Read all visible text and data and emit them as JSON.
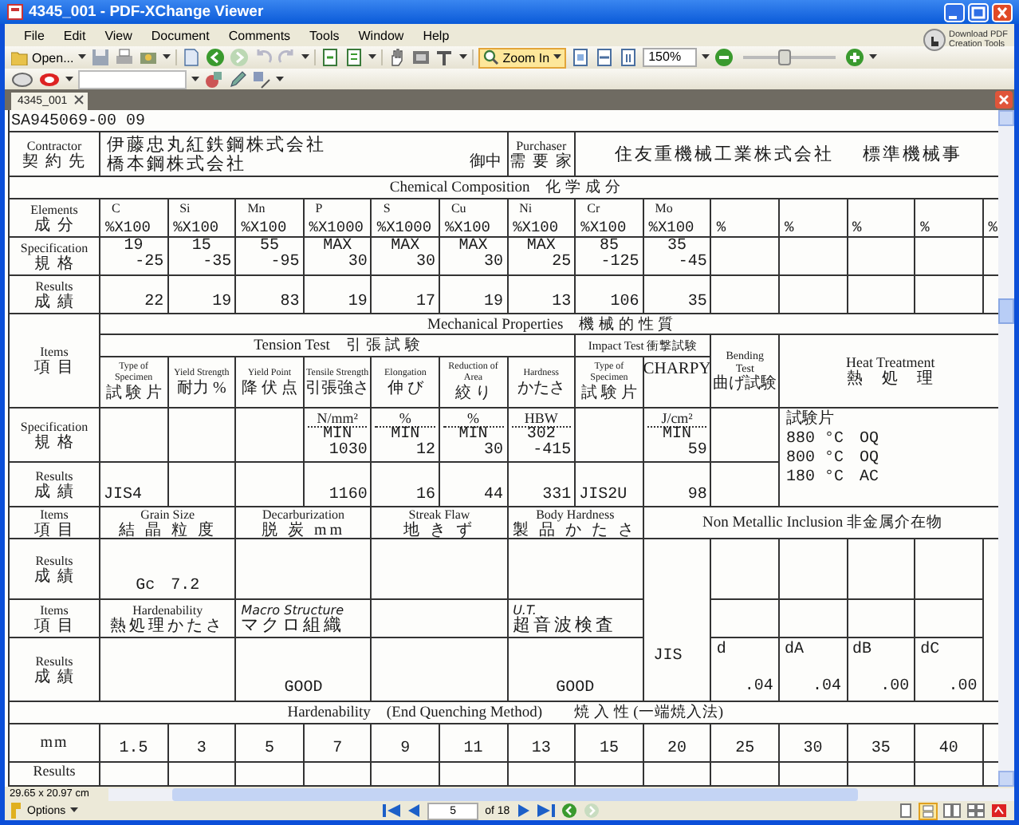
{
  "window": {
    "title": "4345_001 - PDF-XChange Viewer"
  },
  "menu": [
    "File",
    "Edit",
    "View",
    "Document",
    "Comments",
    "Tools",
    "Window",
    "Help"
  ],
  "promo": [
    "Download PDF",
    "Creation Tools"
  ],
  "toolbar": {
    "open_label": "Open...",
    "zoom_tool": {
      "label": "Zoom In",
      "selected": true
    },
    "zoom_value": "150%",
    "zoom_slider": {
      "level": 0.45
    }
  },
  "tabs": [
    {
      "label": "4345_001",
      "selected": true
    }
  ],
  "document": {
    "cert_number": "SA945069-00 09",
    "contractor": {
      "en": "Contractor",
      "ja": "契 約 先",
      "lines": [
        "伊藤忠丸紅鉄鋼株式会社",
        "橋本鋼株式会社"
      ],
      "suffix": "御中"
    },
    "purchaser": {
      "en": "Purchaser",
      "ja": "需 要 家",
      "name": "住友重機械工業株式会社",
      "division": "標準機械事"
    },
    "chemical": {
      "title": "Chemical Composition　化 学 成 分",
      "row_labels": [
        {
          "en": "Elements",
          "ja": "成 分"
        },
        {
          "en": "Specification",
          "ja": "規 格"
        },
        {
          "en": "Results",
          "ja": "成 績"
        }
      ],
      "columns": [
        {
          "element": "C",
          "unit": "%X100",
          "spec": [
            "19",
            "-25"
          ],
          "result": "22"
        },
        {
          "element": "Si",
          "unit": "%X100",
          "spec": [
            "15",
            "-35"
          ],
          "result": "19"
        },
        {
          "element": "Mn",
          "unit": "%X100",
          "spec": [
            "55",
            "-95"
          ],
          "result": "83"
        },
        {
          "element": "P",
          "unit": "%X1000",
          "spec": [
            "MAX",
            "30"
          ],
          "result": "19"
        },
        {
          "element": "S",
          "unit": "%X1000",
          "spec": [
            "MAX",
            "30"
          ],
          "result": "17"
        },
        {
          "element": "Cu",
          "unit": "%X100",
          "spec": [
            "MAX",
            "30"
          ],
          "result": "19"
        },
        {
          "element": "Ni",
          "unit": "%X100",
          "spec": [
            "MAX",
            "25"
          ],
          "result": "13"
        },
        {
          "element": "Cr",
          "unit": "%X100",
          "spec": [
            "85",
            "-125"
          ],
          "result": "106"
        },
        {
          "element": "Mo",
          "unit": "%X100",
          "spec": [
            "35",
            "-45"
          ],
          "result": "35"
        },
        {
          "unit": "%"
        },
        {
          "unit": "%"
        },
        {
          "unit": "%"
        },
        {
          "unit": "%"
        },
        {
          "unit": "%"
        }
      ]
    },
    "mechanical": {
      "title": "Mechanical Properties　機 械 的 性 質",
      "items_label": {
        "en": "Items",
        "ja": "項 目"
      },
      "tension_title": "Tension Test　引 張 試 験",
      "impact_title": "Impact Test 衝撃試験",
      "bending": {
        "en": "Bending Test",
        "ja": "曲げ試験"
      },
      "heat": {
        "en": "Heat Treatment",
        "ja": "熱　処　理",
        "lines": [
          "試験片",
          "880 °C　OQ",
          "800 °C　OQ",
          "180 °C　AC"
        ]
      },
      "row_labels": [
        {
          "en": "Specification",
          "ja": "規 格"
        },
        {
          "en": "Results",
          "ja": "成 績"
        }
      ],
      "columns": [
        {
          "kind": "small",
          "en": "Type of Specimen",
          "ja": "試 験 片",
          "result": "JIS4"
        },
        {
          "kind": "small",
          "en": "Yield Strength",
          "ja": "耐力 %"
        },
        {
          "kind": "small",
          "en": "Yield Point",
          "ja": "降 伏 点"
        },
        {
          "kind": "small",
          "en": "Tensile Strength",
          "ja": "引張強さ",
          "unit": "N/mm²",
          "spec": [
            "MIN",
            "1030"
          ],
          "result": "1160"
        },
        {
          "kind": "small",
          "en": "Elongation",
          "ja": "伸 び",
          "unit": "%",
          "spec": [
            "MIN",
            "12"
          ],
          "result": "16"
        },
        {
          "kind": "small",
          "en": "Reduction of Area",
          "ja": "絞 り",
          "unit": "%",
          "spec": [
            "MIN",
            "30"
          ],
          "result": "44"
        },
        {
          "kind": "small",
          "en": "Hardness",
          "ja": "かたさ",
          "unit": "HBW",
          "spec": [
            "302",
            "-415"
          ],
          "result": "331"
        },
        {
          "kind": "small",
          "en": "Type of Specimen",
          "ja": "試 験 片",
          "result": "JIS2U"
        },
        {
          "kind": "large",
          "en": "CHARPY",
          "unit": "J/cm²",
          "spec": [
            "MIN",
            "59"
          ],
          "result": "98"
        }
      ]
    },
    "lower": [
      {
        "items_label": {
          "en": "Items",
          "ja": "項 目"
        },
        "results_label": {
          "en": "Results",
          "ja": "成 績"
        },
        "tests": [
          {
            "kind": "printed",
            "en": "Grain Size",
            "ja": "結 晶 粒 度",
            "result": "Gc　7.2"
          },
          {
            "kind": "printed",
            "en": "Decarburization",
            "ja": "脱 炭 mm"
          },
          {
            "kind": "printed",
            "en": "Streak Flaw",
            "ja": "地 き ず"
          },
          {
            "kind": "printed",
            "en": "Body Hardness",
            "ja": "製 品 か た さ"
          }
        ]
      },
      {
        "items_label": {
          "en": "Items",
          "ja": "項 目"
        },
        "results_label": {
          "en": "Results",
          "ja": "成 績"
        },
        "tests": [
          {
            "kind": "printed",
            "en": "Hardenability",
            "ja": "熱処理かたさ"
          },
          {
            "kind": "handwritten",
            "en": "Macro Structure",
            "ja": "マクロ組織",
            "result": "GOOD"
          },
          {
            "kind": "blank"
          },
          {
            "kind": "handwritten",
            "en": "U.T.",
            "ja": "超音波検査",
            "result": "GOOD"
          }
        ]
      }
    ],
    "inclusion": {
      "title": "Non Metallic Inclusion 非金属介在物",
      "standard": "JIS",
      "columns": [
        {
          "name": "d",
          "value": ".04"
        },
        {
          "name": "dA",
          "value": ".04"
        },
        {
          "name": "dB",
          "value": ".00"
        },
        {
          "name": "dC",
          "value": ".00"
        }
      ]
    },
    "hardenability": {
      "title": "Hardenability　(End Quenching Method)　　焼 入 性 (一端焼入法)",
      "unit": "mm",
      "distances": [
        "1.5",
        "3",
        "5",
        "7",
        "9",
        "11",
        "13",
        "15",
        "20",
        "25",
        "30",
        "35",
        "40"
      ],
      "results_label": "Results"
    }
  },
  "status": {
    "page_size": "29.65 x 20.97 cm",
    "options": "Options",
    "page": "5",
    "page_count": "of 18"
  }
}
